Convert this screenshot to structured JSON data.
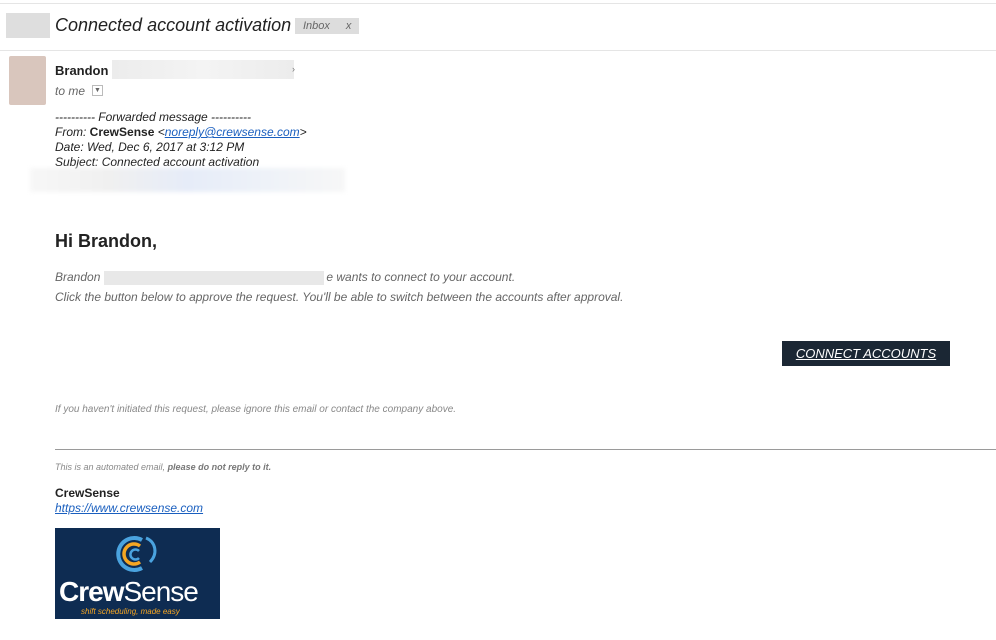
{
  "email": {
    "subject": "Connected account activation",
    "label": "Inbox",
    "label_close": "x",
    "sender": "Brandon I",
    "to": "to me",
    "forwarded": {
      "header": "---------- Forwarded message ----------",
      "from_label": "From: ",
      "from_name": "CrewSense",
      "from_email": "noreply@crewsense.com",
      "date": "Date: Wed, Dec 6, 2017 at 3:12 PM",
      "subject": "Subject: Connected account activation"
    },
    "greeting": "Hi Brandon,",
    "body_line1_start": "Brandon",
    "body_line1_end": "e wants to connect to your account.",
    "body_line2": "Click the button below to approve the request. You'll be able to switch between the accounts after approval.",
    "cta_label": "CONNECT ACCOUNTS",
    "ignore_note": "If you haven't initiated this request, please ignore this email or contact the company above.",
    "automated_prefix": "This is an automated email, ",
    "automated_bold": "please do not reply to it.",
    "signature_name": "CrewSense",
    "signature_link": "https://www.crewsense.com",
    "logo": {
      "word_bold": "Crew",
      "word_regular": "Sense",
      "tagline": "shift scheduling, made easy"
    }
  },
  "colors": {
    "button_bg": "#1b2734",
    "logo_bg": "#0e2c52",
    "link": "#1a5fbf",
    "logo_accent_orange": "#f5a623",
    "logo_accent_blue": "#4aa3df"
  }
}
